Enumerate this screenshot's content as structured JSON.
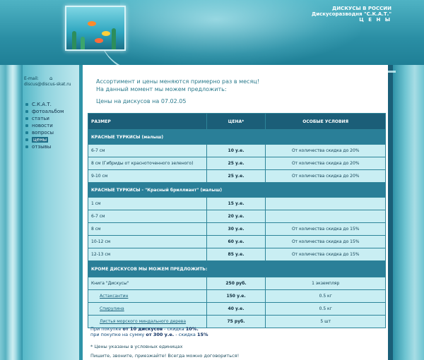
{
  "header": {
    "line1": "ДИСКУСЫ В РОССИИ",
    "line2": "Дискусоразводня \"С.К.А.Т.\"",
    "line3": "Ц Е Н Ы"
  },
  "sidebar": {
    "email_label": "E-mail:",
    "email": "discus@discus-skat.ru",
    "items": [
      {
        "label": "С.К.А.Т."
      },
      {
        "label": "фотоальбом"
      },
      {
        "label": "статьи"
      },
      {
        "label": "новости"
      },
      {
        "label": "вопросы"
      },
      {
        "label": "цены"
      },
      {
        "label": "отзывы"
      }
    ]
  },
  "intro": {
    "line1": "Ассортимент и цены меняются примерно раз в месяц!",
    "line2": "На данный момент мы можем предложить:",
    "date": "Цены на дискусов на 07.02.05"
  },
  "table": {
    "headers": [
      "РАЗМЕР",
      "ЦЕНА*",
      "ОСОБЫЕ УСЛОВИЯ"
    ],
    "section1": "КРАСНЫЕ ТУРКИСЫ (малыш)",
    "rows1": [
      {
        "size": "6-7 см",
        "price": "10 у.е.",
        "cond": "От количества скидка до 20%"
      },
      {
        "size": "8 см (Гибриды от красноточенного зеленого)",
        "price": "25 у.е.",
        "cond": "От количества скидка до 20%"
      },
      {
        "size": "9-10 см",
        "price": "25 у.е.",
        "cond": "От количества скидка до 20%"
      }
    ],
    "section2": "КРАСНЫЕ ТУРКИСЫ - \"Красный бриллиант\" (малыш)",
    "rows2": [
      {
        "size": "1 см",
        "price": "15 у.е.",
        "cond": ""
      },
      {
        "size": "6-7 см",
        "price": "20 у.е.",
        "cond": ""
      },
      {
        "size": "8 см",
        "price": "30 у.е.",
        "cond": "От количества скидка до 15%"
      },
      {
        "size": "10-12 см",
        "price": "60 у.е.",
        "cond": "От количества скидка до 15%"
      },
      {
        "size": "12-13 см",
        "price": "85 у.е.",
        "cond": "От количества скидка до 15%"
      }
    ],
    "section3": "КРОМЕ ДИСКУСОВ МЫ МОЖЕМ ПРЕДЛОЖИТЬ:",
    "rows3": [
      {
        "size": "Книга \"Дискусы\"",
        "price": "250 руб.",
        "cond": "1 экземпляр"
      },
      {
        "size": "Астаксантин",
        "price": "150 у.е.",
        "cond": "0.5 кг"
      },
      {
        "size": "Спирулина",
        "price": "40 у.е.",
        "cond": "0.5 кг"
      },
      {
        "size": "Листья морского миндального дерева",
        "price": "75 руб.",
        "cond": "5 шт"
      }
    ]
  },
  "footer": {
    "l1_pre": "При покупке ",
    "l1_bold1": "от 10 дискусов",
    "l1_mid": " - скидка ",
    "l1_bold2": "10%.",
    "l2_pre": "при покупке на сумму ",
    "l2_bold1": "от 300 у.е.",
    "l2_mid": " - скидка ",
    "l2_bold2": "15%",
    "note1": "* Цены указаны в условных единицах",
    "note2": "Пишите, звоните, приезжайте! Всегда можно договориться!"
  }
}
